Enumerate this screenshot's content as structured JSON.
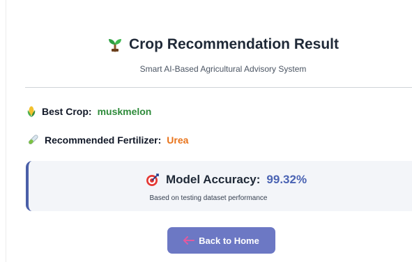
{
  "header": {
    "title": "Crop Recommendation Result",
    "subtitle": "Smart AI-Based Agricultural Advisory System",
    "title_icon": "seedling-icon"
  },
  "results": {
    "crop_label": "Best Crop:",
    "crop_value": "muskmelon",
    "crop_icon": "corn-icon",
    "fertilizer_label": "Recommended Fertilizer:",
    "fertilizer_value": "Urea",
    "fertilizer_icon": "test-tube-icon"
  },
  "accuracy": {
    "label": "Model Accuracy:",
    "value": "99.32%",
    "note": "Based on testing dataset performance",
    "icon": "target-icon"
  },
  "back_button": {
    "label": "Back to Home",
    "icon": "back-arrow-icon"
  },
  "colors": {
    "crop_value": "#2e8b3a",
    "fertilizer_value": "#e8731a",
    "accuracy_value": "#4a63b3",
    "card_border": "#4a5fa8",
    "button_bg": "#6c78c4"
  }
}
